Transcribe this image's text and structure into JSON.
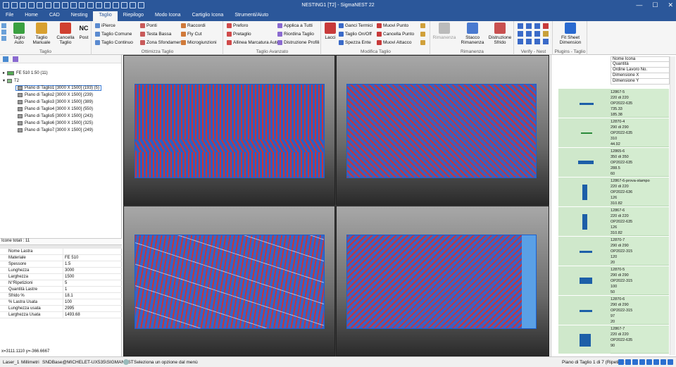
{
  "window": {
    "title": "NESTING1 [T2] - SigmaNEST 22",
    "controls": [
      "—",
      "☐",
      "✕"
    ]
  },
  "menu": {
    "tabs": [
      "File",
      "Home",
      "CAD",
      "Nesting",
      "Taglio",
      "Riepilogo",
      "Modo Icona",
      "Cartiglio Icona",
      "Strumenti/Aiuto"
    ],
    "active": "Taglio"
  },
  "ribbon": {
    "taglio": {
      "label": "Taglio",
      "auto": "Taglio Auto",
      "manuale": "Taglio Manuale",
      "cancella": "Cancella Taglio",
      "post": "Post",
      "nc": "NC"
    },
    "ottimizza": {
      "label": "Ottimizza Taglio",
      "ipierce": "iPierce",
      "comune": "Taglio Comune",
      "continuo": "Taglio Continuo",
      "ponti": "Ponti",
      "testa_bassa": "Testa Bassa",
      "zona": "Zona Sfondamento",
      "raccordi": "Raccordi",
      "flycut": "Fly Cut",
      "micro": "Microgiunzioni"
    },
    "avanzato": {
      "label": "Taglio Avanzato",
      "preforo": "Preforo",
      "pretaglio": "Pretaglio",
      "allinea": "Allinea Marcatura Auto",
      "applica": "Applica a Tutti",
      "riordina": "Riordina Taglio",
      "distruzione": "Distruzione Profili"
    },
    "modifica": {
      "label": "Modifica Taglio",
      "lacci": "Lacci",
      "ganci": "Ganci Termici",
      "onoff": "Taglio On/Off",
      "spezza": "Spezza Ente",
      "muovi_punto": "Muovi Punto",
      "cancella_punto": "Cancella Punto",
      "muovi_attacco": "Muovi Attacco"
    },
    "rimanenza": {
      "label": "Rimanenza",
      "rimanenza": "Rimanenza",
      "stacco": "Stacco Rimanenza",
      "distruzione": "Distruzione Sfrido"
    },
    "verify": {
      "label": "Verify - Nest"
    },
    "plugins": {
      "label": "Plugins - Taglio",
      "fit": "Fit Sheet Dimension"
    }
  },
  "tree": {
    "material": "FE 510 1.50 (11)",
    "group": "T2",
    "plates": [
      "Piano di Taglio1 [3000 X 1500] (193) (5)",
      "Piano di Taglio2 [3000 X 1500] (239)",
      "Piano di Taglio3 [3000 X 1500] (389)",
      "Piano di Taglio4 [3000 X 1500] (550)",
      "Piano di Taglio5 [3000 X 1500] (243)",
      "Piano di Taglio6 [3000 X 1500] (325)",
      "Piano di Taglio7 [3000 X 1500] (249)"
    ]
  },
  "totali": "Icone totali : 11",
  "properties": [
    {
      "k": "Nome Lastra",
      "v": ""
    },
    {
      "k": "Materiale",
      "v": "FE 510"
    },
    {
      "k": "Spessore",
      "v": "1.5"
    },
    {
      "k": "Lunghezza",
      "v": "3000"
    },
    {
      "k": "Larghezza",
      "v": "1500"
    },
    {
      "k": "N°Ripetizioni",
      "v": "5"
    },
    {
      "k": "Quantità Lastre",
      "v": "1"
    },
    {
      "k": "Sfrido %",
      "v": "18.1"
    },
    {
      "k": "% Lastra Usata",
      "v": "100"
    },
    {
      "k": "Lunghezza usata",
      "v": "2995"
    },
    {
      "k": "Larghezza Usata",
      "v": "1493.68"
    }
  ],
  "coords": "x=3111.1110 y=-366.6667",
  "right_headers": [
    "Nome Icona",
    "Quantità",
    "Ordine Lavoro No.",
    "Dimensione X",
    "Dimensione Y"
  ],
  "parts": [
    {
      "l": [
        "12867-5",
        "220 di 220",
        "OP2022-635",
        "735.33",
        "185.38"
      ]
    },
    {
      "l": [
        "12870-4",
        "290 di 290",
        "OP2022-635",
        "310",
        "44.92"
      ]
    },
    {
      "l": [
        "12865-6",
        "350 di 350",
        "OP2022-635",
        "288.5",
        "60"
      ]
    },
    {
      "l": [
        "12867-6-prova-stampo",
        "220 di 220",
        "OP2022-636",
        "126",
        "310.82"
      ]
    },
    {
      "l": [
        "12867-6",
        "220 di 220",
        "OP2022-635",
        "126",
        "310.82"
      ]
    },
    {
      "l": [
        "12870-7",
        "290 di 290",
        "OP2022-315",
        "120",
        "20"
      ]
    },
    {
      "l": [
        "12870-5",
        "290 di 290",
        "OP2022-315",
        "100",
        "50"
      ]
    },
    {
      "l": [
        "12870-6",
        "290 di 290",
        "OP2022-315",
        "97",
        "20"
      ]
    },
    {
      "l": [
        "12867-7",
        "220 di 220",
        "OP2022-635",
        "90",
        ""
      ]
    }
  ],
  "status": {
    "machine": "Laser_1",
    "units": "Millimetri",
    "db": "SNDBase@MICHELET-UX535\\SIGMANEST",
    "hint": "Seleziona un opzione dal menù",
    "page": "Piano di Taglio 1 di 7 (Ripeti 5):"
  }
}
